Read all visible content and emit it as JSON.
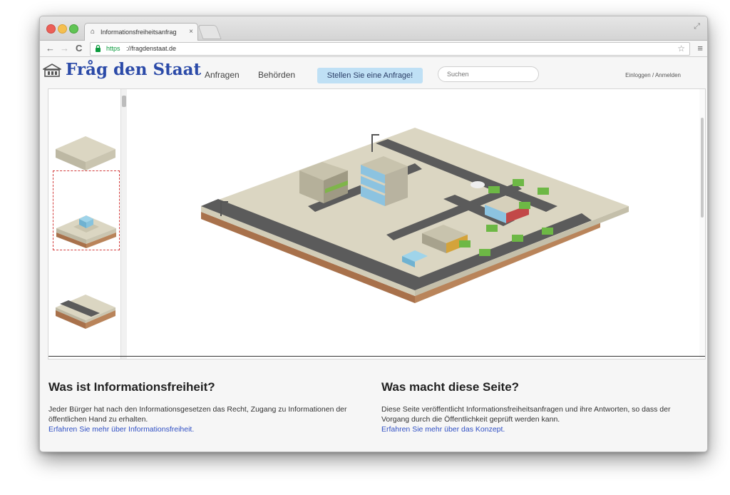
{
  "browser": {
    "tab_title": "Informationsfreiheitsanfrag",
    "tab_close": "×",
    "url_protocol": "https",
    "url_rest": "://fragdenstaat.de",
    "nav_back": "←",
    "nav_forward": "→",
    "nav_reload": "C",
    "star": "☆",
    "menu": "≡",
    "fullscreen": "⤢"
  },
  "site": {
    "logo": "Fråg den Staat",
    "nav": [
      "Anfragen",
      "Behörden"
    ],
    "cta": "Stellen Sie eine Anfrage!",
    "search_placeholder": "Suchen",
    "login": "Einloggen / Anmelden"
  },
  "sections": {
    "left": {
      "title": "Was ist Informationsfreiheit?",
      "text": "Jeder Bürger hat nach den Informationsgesetzen das Recht, Zugang zu Informationen der öffentlichen Hand zu erhalten.",
      "link": "Erfahren Sie mehr über Informationsfreiheit."
    },
    "right": {
      "title": "Was macht diese Seite?",
      "text": "Diese Seite veröffentlicht Informationsfreiheitsanfragen und ihre Antworten, so dass der Vorgang durch die Öffentlichkeit geprüft werden kann.",
      "link": "Erfahren Sie mehr über das Konzept."
    }
  },
  "colors": {
    "logo": "#2b4aa8",
    "link": "#2f4fc4",
    "cta_bg": "#bfe0f5",
    "ground": "#dbd6c2",
    "road": "#5b5b5b",
    "earth": "#b9845a"
  }
}
